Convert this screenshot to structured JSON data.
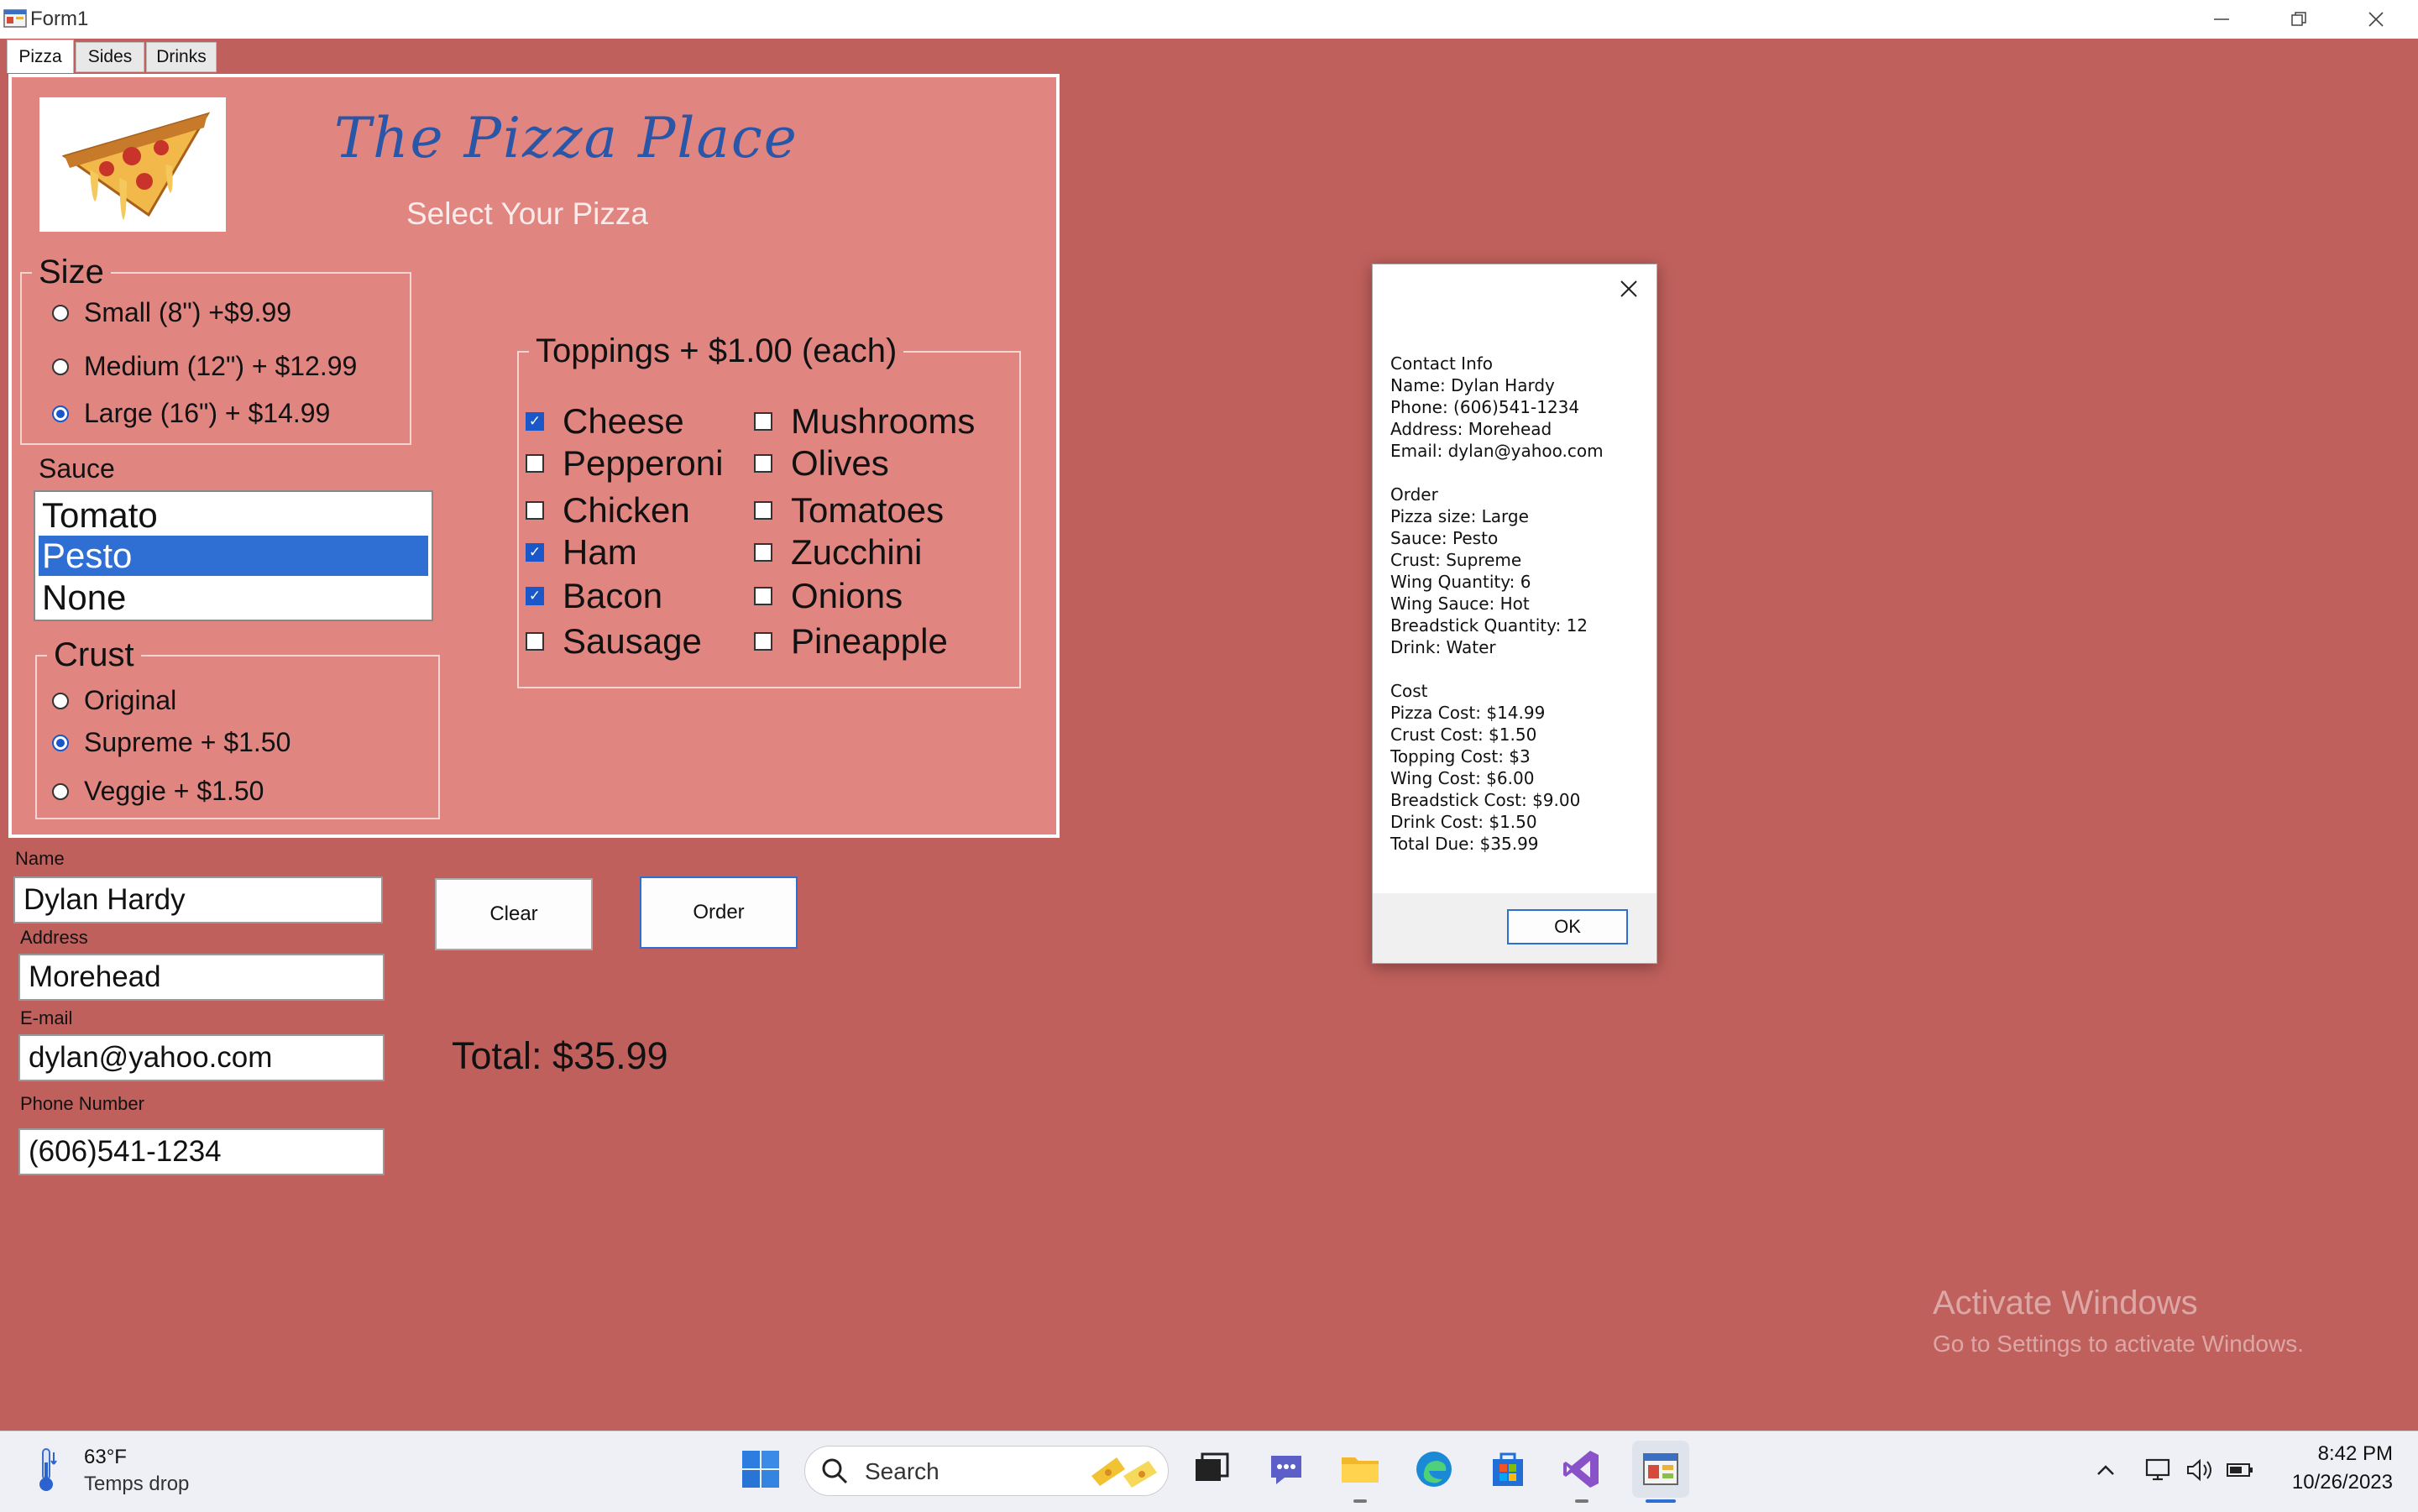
{
  "window": {
    "title": "Form1",
    "minimize_icon": "minimize-icon",
    "maximize_icon": "restore-icon",
    "close_icon": "close-icon"
  },
  "tabs": [
    {
      "label": "Pizza",
      "active": true
    },
    {
      "label": "Sides",
      "active": false
    },
    {
      "label": "Drinks",
      "active": false
    }
  ],
  "pizza": {
    "title": "The Pizza Place",
    "subtitle": "Select Your Pizza",
    "logo_icon": "pizza-slice-icon",
    "size": {
      "legend": "Size",
      "options": [
        {
          "label": "Small (8\") +$9.99",
          "selected": false
        },
        {
          "label": "Medium (12\") + $12.99",
          "selected": false
        },
        {
          "label": "Large (16\") + $14.99",
          "selected": true
        }
      ]
    },
    "sauce": {
      "label": "Sauce",
      "options": [
        "Tomato",
        "Pesto",
        "None"
      ],
      "selected": "Pesto"
    },
    "crust": {
      "legend": "Crust",
      "options": [
        {
          "label": "Original",
          "selected": false
        },
        {
          "label": "Supreme + $1.50",
          "selected": true
        },
        {
          "label": "Veggie + $1.50",
          "selected": false
        }
      ]
    },
    "toppings": {
      "legend": "Toppings + $1.00 (each)",
      "items": [
        {
          "label": "Cheese",
          "checked": true
        },
        {
          "label": "Pepperoni",
          "checked": false
        },
        {
          "label": "Chicken",
          "checked": false
        },
        {
          "label": "Ham",
          "checked": true
        },
        {
          "label": "Bacon",
          "checked": true
        },
        {
          "label": "Sausage",
          "checked": false
        },
        {
          "label": "Mushrooms",
          "checked": false
        },
        {
          "label": "Olives",
          "checked": false
        },
        {
          "label": "Tomatoes",
          "checked": false
        },
        {
          "label": "Zucchini",
          "checked": false
        },
        {
          "label": "Onions",
          "checked": false
        },
        {
          "label": "Pineapple",
          "checked": false
        }
      ]
    }
  },
  "customer": {
    "name_label": "Name",
    "name_value": "Dylan Hardy",
    "address_label": "Address",
    "address_value": "Morehead",
    "email_label": "E-mail",
    "email_value": "dylan@yahoo.com",
    "phone_label": "Phone Number",
    "phone_value": "(606)541-1234"
  },
  "actions": {
    "clear_label": "Clear",
    "order_label": "Order",
    "total_text": "Total: $35.99"
  },
  "dialog": {
    "close_icon": "close-icon",
    "lines": [
      "Contact Info",
      "Name: Dylan Hardy",
      "Phone: (606)541-1234",
      "Address: Morehead",
      "Email: dylan@yahoo.com",
      "",
      "Order",
      "Pizza size: Large",
      "Sauce: Pesto",
      "Crust: Supreme",
      "Wing Quantity: 6",
      "Wing Sauce: Hot",
      "Breadstick Quantity: 12",
      "Drink: Water",
      "",
      "Cost",
      "Pizza Cost: $14.99",
      "Crust Cost: $1.50",
      "Topping Cost: $3",
      "Wing Cost: $6.00",
      "Breadstick Cost: $9.00",
      "Drink Cost: $1.50",
      "Total Due: $35.99"
    ],
    "ok_label": "OK"
  },
  "watermark": {
    "line1": "Activate Windows",
    "line2": "Go to Settings to activate Windows."
  },
  "taskbar": {
    "weather_temp": "63°F",
    "weather_desc": "Temps drop",
    "weather_icon": "thermometer-icon",
    "search_placeholder": "Search",
    "apps": [
      "windows-start-icon",
      "task-view-icon",
      "teams-chat-icon",
      "file-explorer-icon",
      "edge-browser-icon",
      "microsoft-store-icon",
      "visual-studio-icon",
      "form-app-icon"
    ],
    "tray_icons": [
      "chevron-up-icon",
      "network-icon",
      "volume-icon",
      "battery-icon"
    ],
    "time": "8:42 PM",
    "date": "10/26/2023"
  },
  "colors": {
    "form_background": "#c0605c",
    "tab_page_background": "#e08580",
    "title_blue": "#2a56a8",
    "selection_blue": "#2f6fd4"
  }
}
